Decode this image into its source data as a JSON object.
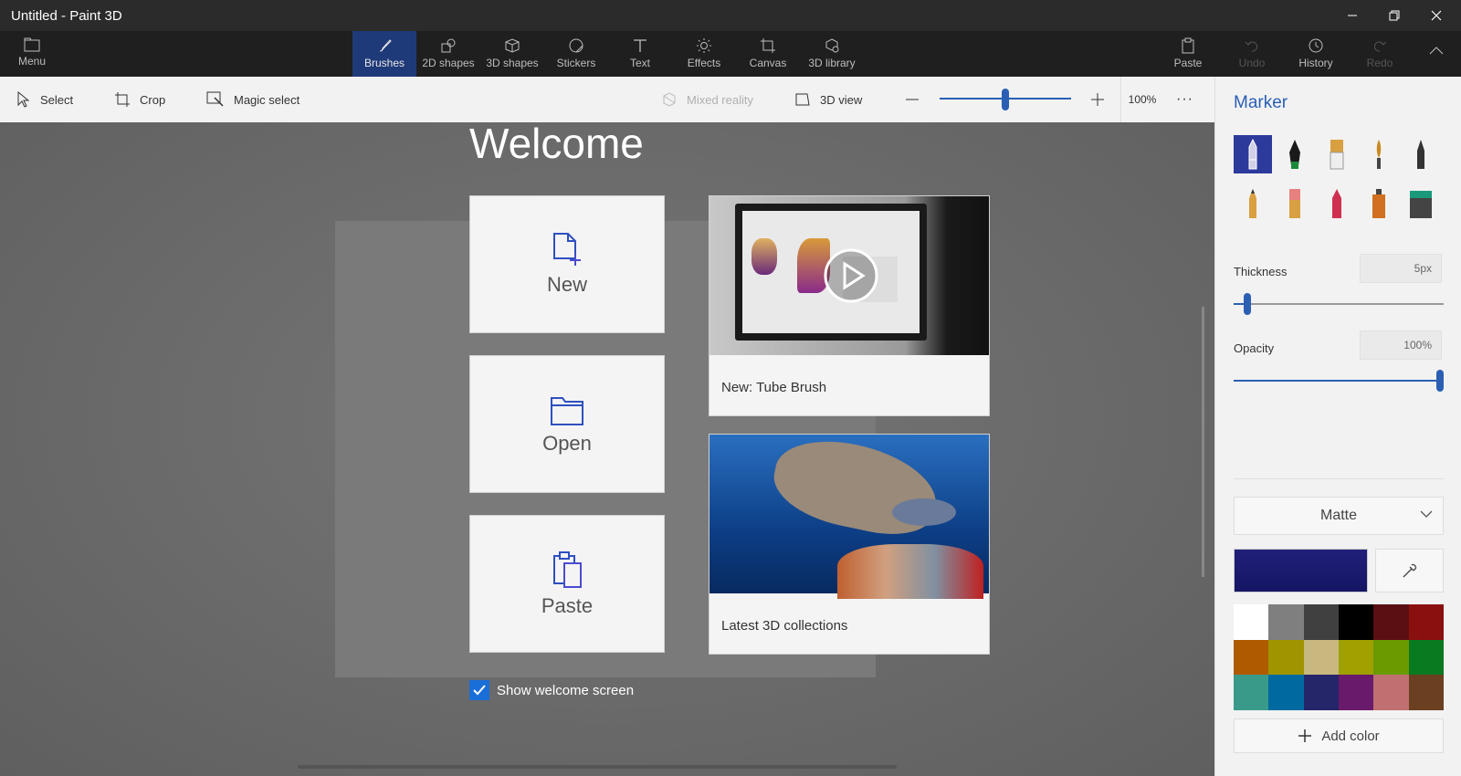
{
  "window": {
    "title": "Untitled - Paint 3D"
  },
  "topbar": {
    "menu_label": "Menu",
    "tools": [
      {
        "label": "Brushes",
        "active": true
      },
      {
        "label": "2D shapes"
      },
      {
        "label": "3D shapes"
      },
      {
        "label": "Stickers"
      },
      {
        "label": "Text"
      },
      {
        "label": "Effects"
      },
      {
        "label": "Canvas"
      },
      {
        "label": "3D library"
      }
    ],
    "right": [
      {
        "label": "Paste"
      },
      {
        "label": "Undo",
        "disabled": true
      },
      {
        "label": "History"
      },
      {
        "label": "Redo",
        "disabled": true
      }
    ]
  },
  "toolbar": {
    "select": "Select",
    "crop": "Crop",
    "magic_select": "Magic select",
    "mixed_reality": "Mixed reality",
    "view3d": "3D view",
    "zoom_value": "100%",
    "zoom_level": 0.5
  },
  "welcome": {
    "title": "Welcome",
    "new": "New",
    "open": "Open",
    "paste": "Paste",
    "video1_caption": "New: Tube Brush",
    "video2_caption": "Latest 3D collections",
    "show_welcome": "Show welcome screen"
  },
  "panel": {
    "title": "Marker",
    "thickness_label": "Thickness",
    "thickness_value": "5px",
    "thickness_level": 0.05,
    "opacity_label": "Opacity",
    "opacity_value": "100%",
    "opacity_level": 1.0,
    "finish": "Matte",
    "add_color": "Add color",
    "current_color": "#20207a",
    "palette": [
      "#ffffff",
      "#7f7f7f",
      "#404040",
      "#000000",
      "#5c0f12",
      "#8a1010",
      "#b05a00",
      "#a09400",
      "#c8b880",
      "#a0a000",
      "#6a9a00",
      "#0a7a20",
      "#3a9a8a",
      "#006aa0",
      "#25256a",
      "#6a1a6a",
      "#c07070",
      "#6a4020"
    ]
  }
}
